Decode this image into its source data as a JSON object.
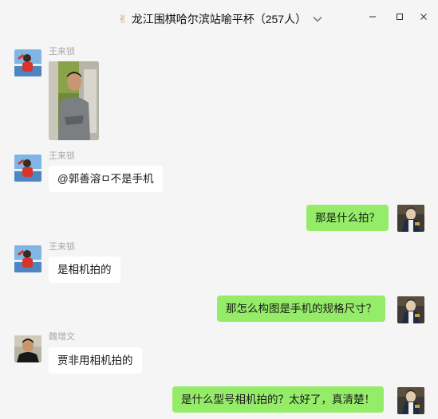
{
  "window": {
    "emoji": "✌",
    "title": "龙江围棋哈尔滨站喻平杯",
    "member_count": "（257人）"
  },
  "messages": [
    {
      "sender": "王来锁",
      "type": "image"
    },
    {
      "sender": "王来锁",
      "text": "@郭善溶ㅁ不是手机"
    },
    {
      "direction": "out",
      "text": "那是什么拍？"
    },
    {
      "sender": "王来锁",
      "text": "是相机拍的"
    },
    {
      "direction": "out",
      "text": "那怎么构图是手机的规格尺寸？"
    },
    {
      "sender": "魏增文",
      "text": "贾非用相机拍的"
    },
    {
      "direction": "out",
      "text": "是什么型号相机拍的？太好了，真清楚！"
    }
  ],
  "colors": {
    "incoming_bubble": "#ffffff",
    "outgoing_bubble": "#95ec69",
    "background": "#f5f5f5",
    "sender_name": "#a9a9a9"
  },
  "icons": [
    "victory-hand-icon",
    "chevron-down-icon",
    "minimize-icon",
    "maximize-icon",
    "close-icon"
  ]
}
